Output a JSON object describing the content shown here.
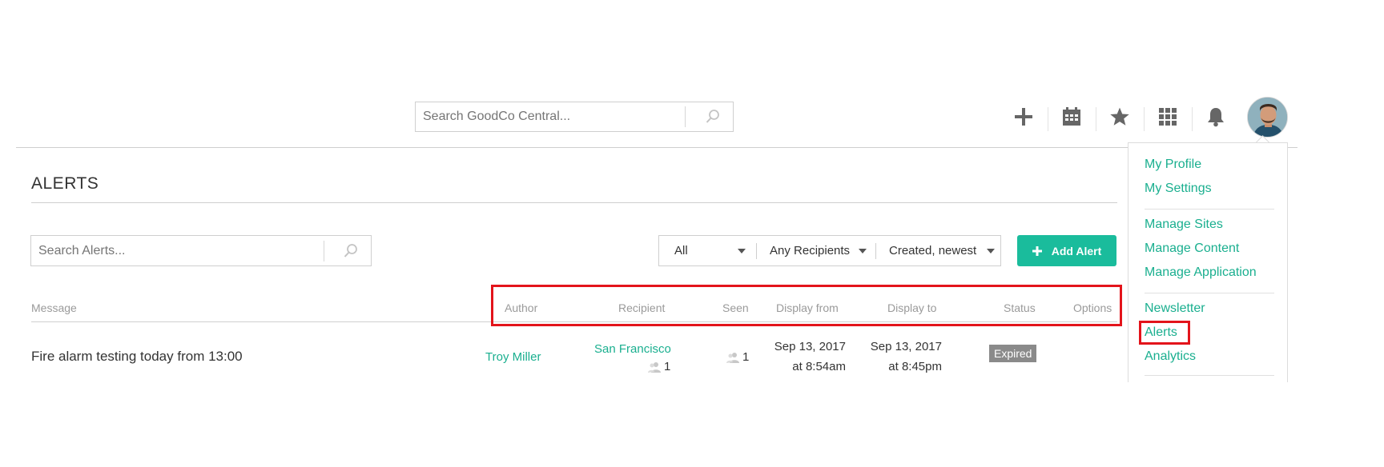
{
  "header": {
    "search_placeholder": "Search GoodCo Central...",
    "toolbar_icons": [
      "plus-icon",
      "calendar-icon",
      "star-icon",
      "apps-grid-icon",
      "bell-icon"
    ]
  },
  "page": {
    "title": "ALERTS",
    "search_placeholder": "Search Alerts...",
    "filters": {
      "type": "All",
      "recipients": "Any Recipients",
      "sort": "Created, newest"
    },
    "add_button_label": "Add Alert"
  },
  "table": {
    "columns": {
      "message": "Message",
      "author": "Author",
      "recipient": "Recipient",
      "seen": "Seen",
      "display_from": "Display from",
      "display_to": "Display to",
      "status": "Status",
      "options": "Options"
    },
    "rows": [
      {
        "message": "Fire alarm testing today from 13:00",
        "author": "Troy Miller",
        "recipient": "San Francisco",
        "recipient_count": "1",
        "seen": "1",
        "display_from_date": "Sep 13, 2017",
        "display_from_time": "at 8:54am",
        "display_to_date": "Sep 13, 2017",
        "display_to_time": "at 8:45pm",
        "status": "Expired"
      }
    ]
  },
  "user_menu": {
    "items": [
      "My Profile",
      "My Settings",
      "Manage Sites",
      "Manage Content",
      "Manage Application",
      "Newsletter",
      "Alerts",
      "Analytics"
    ]
  },
  "colors": {
    "accent": "#1abc9c",
    "link": "#1aaf8f",
    "highlight": "#e3141b",
    "badge": "#8a8a8a"
  }
}
